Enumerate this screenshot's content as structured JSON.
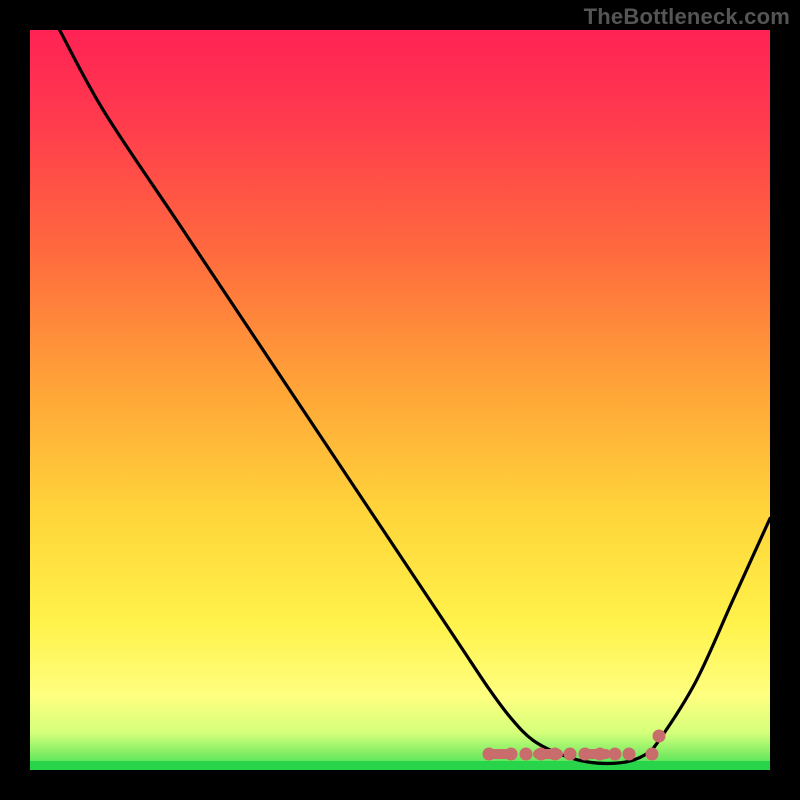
{
  "watermark": "TheBottleneck.com",
  "colors": {
    "background": "#000000",
    "gradient_top": "#ff2255",
    "gradient_bottom": "#3fe055",
    "curve": "#000000",
    "markers": "#c96d6c"
  },
  "chart_data": {
    "type": "line",
    "title": "",
    "xlabel": "",
    "ylabel": "",
    "xlim": [
      0,
      100
    ],
    "ylim": [
      0,
      100
    ],
    "series": [
      {
        "name": "bottleneck-curve",
        "x": [
          4,
          10,
          20,
          30,
          40,
          50,
          58,
          62,
          65,
          68,
          72,
          76,
          80,
          83,
          85,
          90,
          95,
          100
        ],
        "y": [
          100,
          89,
          74,
          59,
          44,
          29,
          17,
          11,
          7,
          4,
          2,
          1,
          1,
          2,
          4,
          12,
          23,
          34
        ]
      }
    ],
    "markers": {
      "valley_dots_x": [
        62,
        65,
        67,
        69,
        71,
        73,
        75,
        77,
        79,
        81,
        84
      ],
      "raised_dot_x": 85,
      "dashes": [
        {
          "x": 63.5,
          "w": 3
        },
        {
          "x": 70.0,
          "w": 4
        },
        {
          "x": 76.5,
          "w": 4
        }
      ]
    }
  }
}
